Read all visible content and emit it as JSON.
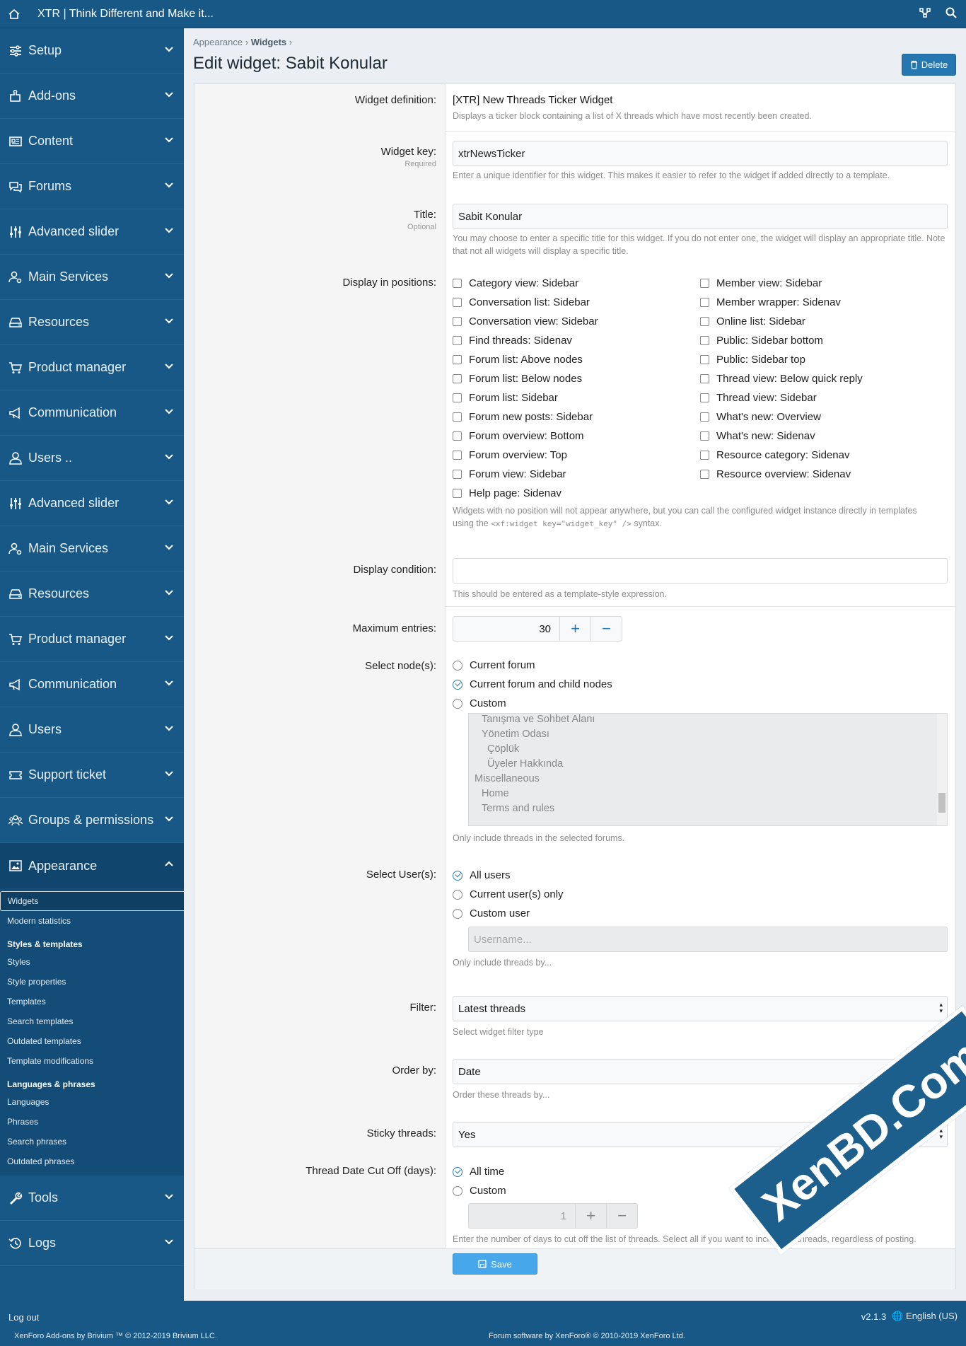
{
  "topbar": {
    "title": "XTR | Think Different and Make it..."
  },
  "sidebar": {
    "sections_top": [
      {
        "label": "Setup",
        "icon": "sliders-icon"
      },
      {
        "label": "Add-ons",
        "icon": "puzzle-icon"
      },
      {
        "label": "Content",
        "icon": "newspaper-icon"
      },
      {
        "label": "Forums",
        "icon": "comments-icon"
      },
      {
        "label": "Advanced slider",
        "icon": "sliders-vertical-icon"
      },
      {
        "label": "Main Services",
        "icon": "user-gear-icon"
      },
      {
        "label": "Resources",
        "icon": "hdd-icon"
      },
      {
        "label": "Product manager",
        "icon": "cart-icon"
      },
      {
        "label": "Communication",
        "icon": "megaphone-icon"
      },
      {
        "label": "Users ..",
        "icon": "user-icon"
      },
      {
        "label": "Advanced slider",
        "icon": "sliders-vertical-icon"
      },
      {
        "label": "Main Services",
        "icon": "user-gear-icon"
      },
      {
        "label": "Resources",
        "icon": "hdd-icon"
      },
      {
        "label": "Product manager",
        "icon": "cart-icon"
      },
      {
        "label": "Communication",
        "icon": "megaphone-icon"
      },
      {
        "label": "Users",
        "icon": "user-icon"
      },
      {
        "label": "Support ticket",
        "icon": "ticket-icon"
      },
      {
        "label": "Groups & permissions",
        "icon": "users-icon"
      }
    ],
    "appearance": {
      "label": "Appearance",
      "icon": "image-icon",
      "items": [
        {
          "t": "item",
          "label": "Widgets",
          "selected": true
        },
        {
          "t": "item",
          "label": "Modern statistics"
        },
        {
          "t": "head",
          "label": "Styles & templates"
        },
        {
          "t": "item",
          "label": "Styles"
        },
        {
          "t": "item",
          "label": "Style properties"
        },
        {
          "t": "item",
          "label": "Templates"
        },
        {
          "t": "item",
          "label": "Search templates"
        },
        {
          "t": "item",
          "label": "Outdated templates"
        },
        {
          "t": "item",
          "label": "Template modifications"
        },
        {
          "t": "head",
          "label": "Languages & phrases"
        },
        {
          "t": "item",
          "label": "Languages"
        },
        {
          "t": "item",
          "label": "Phrases"
        },
        {
          "t": "item",
          "label": "Search phrases"
        },
        {
          "t": "item",
          "label": "Outdated phrases"
        }
      ]
    },
    "sections_bottom": [
      {
        "label": "Tools",
        "icon": "wrench-icon"
      },
      {
        "label": "Logs",
        "icon": "history-icon"
      }
    ]
  },
  "breadcrumb": {
    "first": "Appearance",
    "second": "Widgets"
  },
  "page": {
    "title": "Edit widget: Sabit Konular",
    "delete_label": "Delete"
  },
  "form": {
    "definition": {
      "label": "Widget definition:",
      "value": "[XTR] New Threads Ticker Widget",
      "hint": "Displays a ticker block containing a list of X threads which have most recently been created."
    },
    "key": {
      "label": "Widget key:",
      "sub": "Required",
      "value": "xtrNewsTicker",
      "hint": "Enter a unique identifier for this widget. This makes it easier to refer to the widget if added directly to a template."
    },
    "title": {
      "label": "Title:",
      "sub": "Optional",
      "value": "Sabit Konular",
      "hint": "You may choose to enter a specific title for this widget. If you do not enter one, the widget will display an appropriate title. Note that not all widgets will display a specific title."
    },
    "positions": {
      "label": "Display in positions:",
      "left": [
        "Category view: Sidebar",
        "Conversation list: Sidebar",
        "Conversation view: Sidebar",
        "Find threads: Sidenav",
        "Forum list: Above nodes",
        "Forum list: Below nodes",
        "Forum list: Sidebar",
        "Forum new posts: Sidebar",
        "Forum overview: Bottom",
        "Forum overview: Top",
        "Forum view: Sidebar",
        "Help page: Sidenav"
      ],
      "right": [
        "Member view: Sidebar",
        "Member wrapper: Sidenav",
        "Online list: Sidebar",
        "Public: Sidebar bottom",
        "Public: Sidebar top",
        "Thread view: Below quick reply",
        "Thread view: Sidebar",
        "What's new: Overview",
        "What's new: Sidenav",
        "Resource category: Sidenav",
        "Resource overview: Sidenav"
      ],
      "hint1": "Widgets with no position will not appear anywhere, but you can call the configured widget instance directly in templates",
      "hint2_pre": "using the ",
      "hint2_code": "<xf:widget key=\"widget_key\" />",
      "hint2_post": " syntax."
    },
    "condition": {
      "label": "Display condition:",
      "value": "",
      "hint": "This should be entered as a template-style expression."
    },
    "max": {
      "label": "Maximum entries:",
      "value": "30"
    },
    "nodes": {
      "label": "Select node(s):",
      "options": [
        {
          "label": "Current forum",
          "checked": false
        },
        {
          "label": "Current forum and child nodes",
          "checked": true
        },
        {
          "label": "Custom",
          "checked": false
        }
      ],
      "list": [
        {
          "label": "Tanışma ve Sohbet Alanı",
          "indent": 1
        },
        {
          "label": "Yönetim Odası",
          "indent": 1
        },
        {
          "label": "Çöplük",
          "indent": 2
        },
        {
          "label": "Üyeler Hakkında",
          "indent": 2
        },
        {
          "label": "Miscellaneous",
          "indent": 0
        },
        {
          "label": "Home",
          "indent": 1
        },
        {
          "label": "Terms and rules",
          "indent": 1
        }
      ],
      "hint": "Only include threads in the selected forums."
    },
    "users": {
      "label": "Select User(s):",
      "options": [
        {
          "label": "All users",
          "checked": true
        },
        {
          "label": "Current user(s) only",
          "checked": false
        },
        {
          "label": "Custom user",
          "checked": false
        }
      ],
      "placeholder": "Username...",
      "hint": "Only include threads by..."
    },
    "filter": {
      "label": "Filter:",
      "value": "Latest threads",
      "hint": "Select widget filter type"
    },
    "order": {
      "label": "Order by:",
      "value": "Date",
      "hint": "Order these threads by..."
    },
    "sticky": {
      "label": "Sticky threads:",
      "value": "Yes"
    },
    "cutoff": {
      "label": "Thread Date Cut Off (days):",
      "options": [
        {
          "label": "All time",
          "checked": true
        },
        {
          "label": "Custom",
          "checked": false
        }
      ],
      "value": "1",
      "hint": "Enter the number of days to cut off the list of threads. Select all if you want to include all threads, regardless of posting."
    },
    "save_label": "Save"
  },
  "footer": {
    "logout": "Log out",
    "copy_left": "XenForo Add-ons by Brivium ™ © 2012-2019 Brivium LLC.",
    "copy_center": "Forum software by XenForo® © 2010-2019 XenForo Ltd.",
    "version": "v2.1.3",
    "language": "English (US)"
  },
  "watermark": "XenBD.Com"
}
